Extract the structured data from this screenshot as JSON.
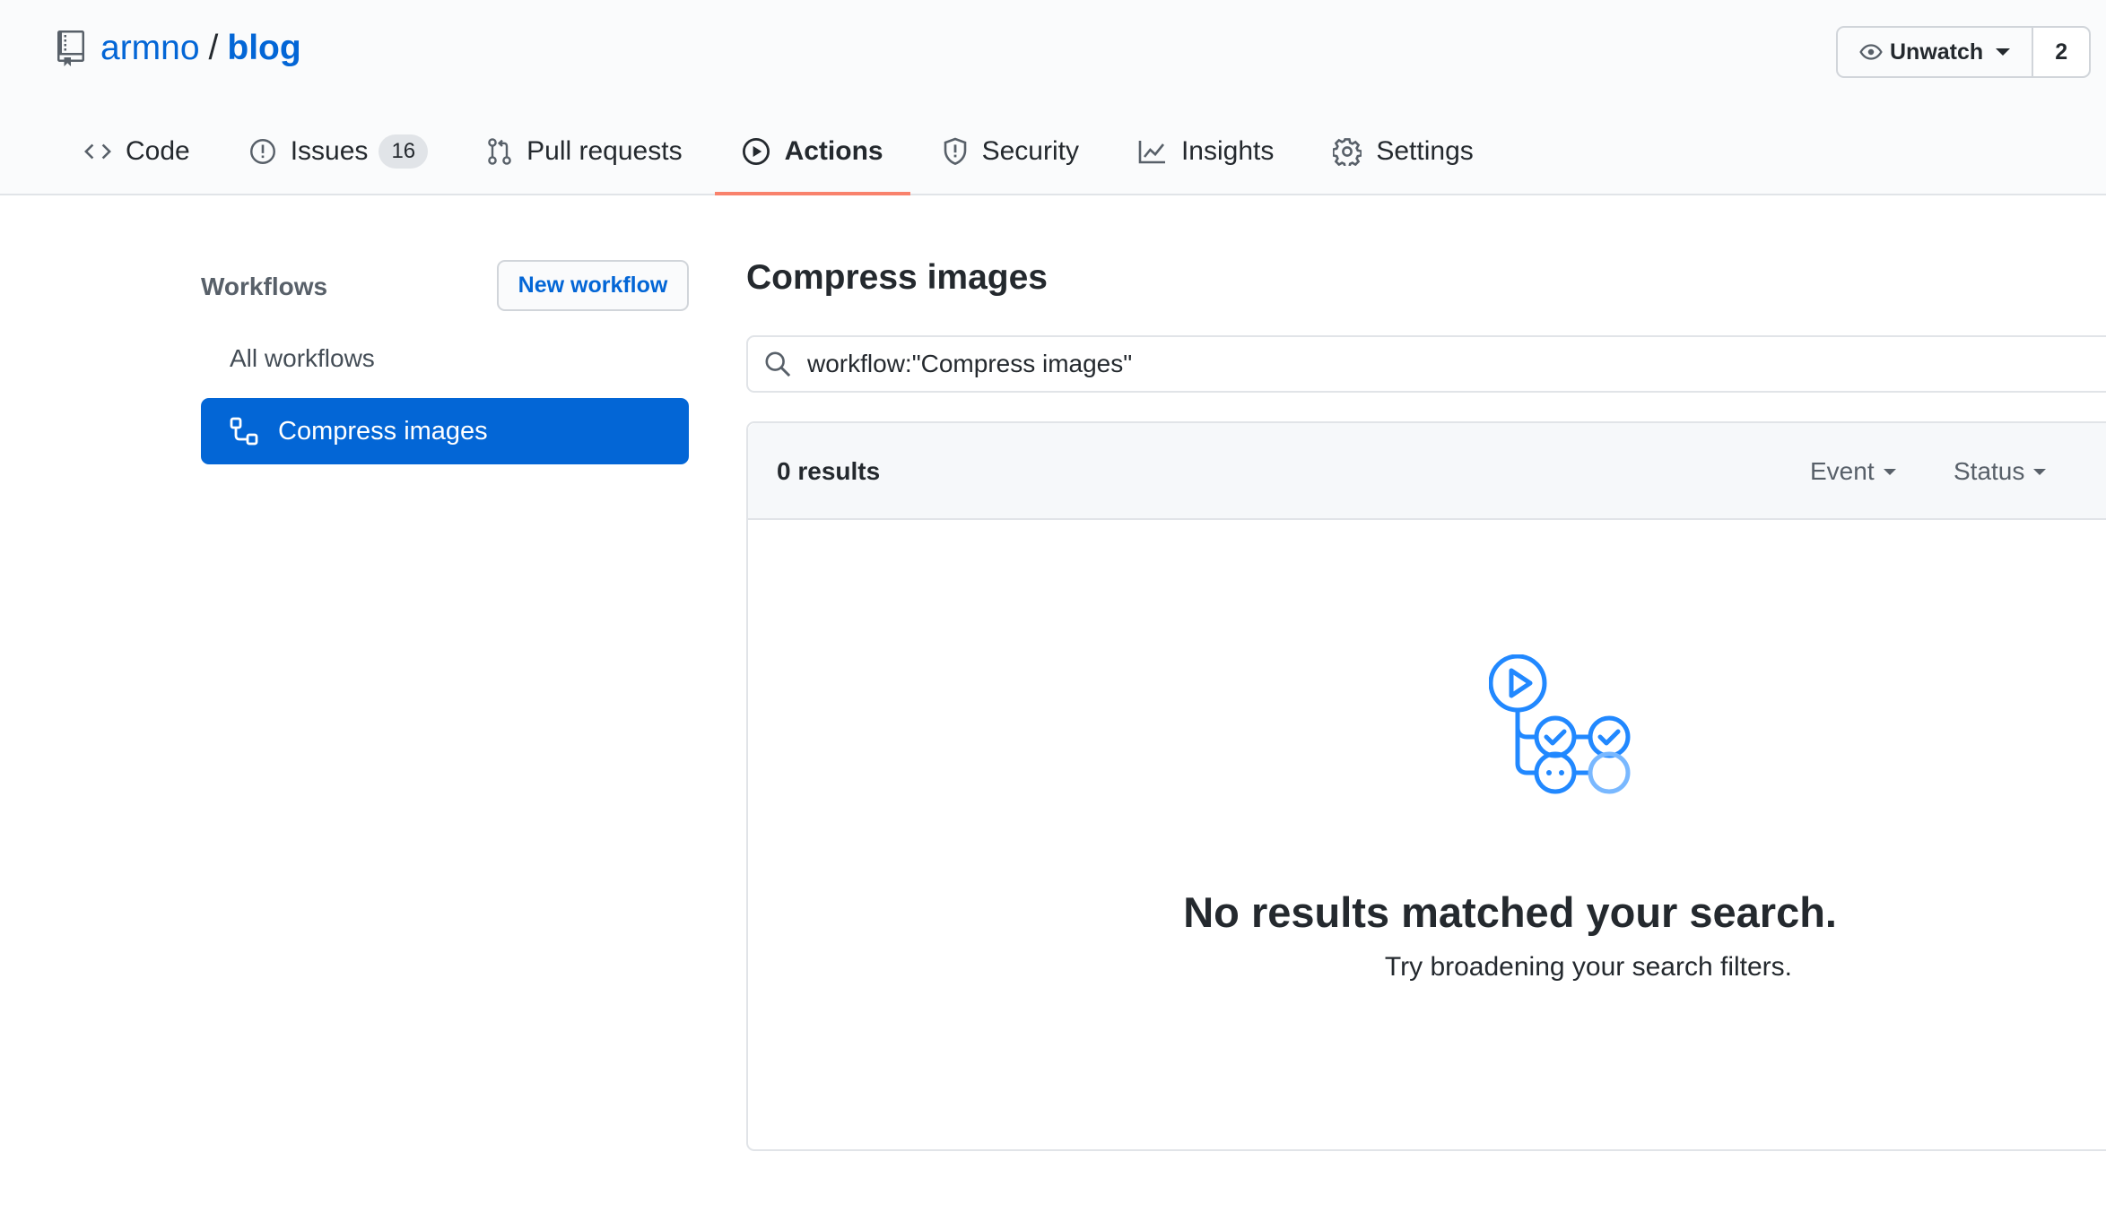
{
  "repo": {
    "owner": "armno",
    "separator": "/",
    "name": "blog"
  },
  "watch": {
    "label": "Unwatch",
    "count": "2"
  },
  "tabs": [
    {
      "label": "Code",
      "icon": "code-icon"
    },
    {
      "label": "Issues",
      "icon": "issue-icon",
      "counter": "16"
    },
    {
      "label": "Pull requests",
      "icon": "pull-request-icon"
    },
    {
      "label": "Actions",
      "icon": "play-icon",
      "active": true
    },
    {
      "label": "Security",
      "icon": "shield-icon"
    },
    {
      "label": "Insights",
      "icon": "graph-icon"
    },
    {
      "label": "Settings",
      "icon": "gear-icon"
    }
  ],
  "sidebar": {
    "title": "Workflows",
    "new_workflow": "New workflow",
    "all_workflows": "All workflows",
    "selected_workflow": "Compress images"
  },
  "main": {
    "title": "Compress images",
    "search_value": "workflow:\"Compress images\"",
    "results_count": "0 results",
    "filter_event": "Event",
    "filter_status": "Status",
    "empty_title": "No results matched your search.",
    "empty_subtitle": "Try broadening your search filters."
  },
  "colors": {
    "link": "#0366d6",
    "active_tab_underline": "#f9826c",
    "selected_bg": "#0366d6",
    "header_bg": "#fafbfc"
  }
}
